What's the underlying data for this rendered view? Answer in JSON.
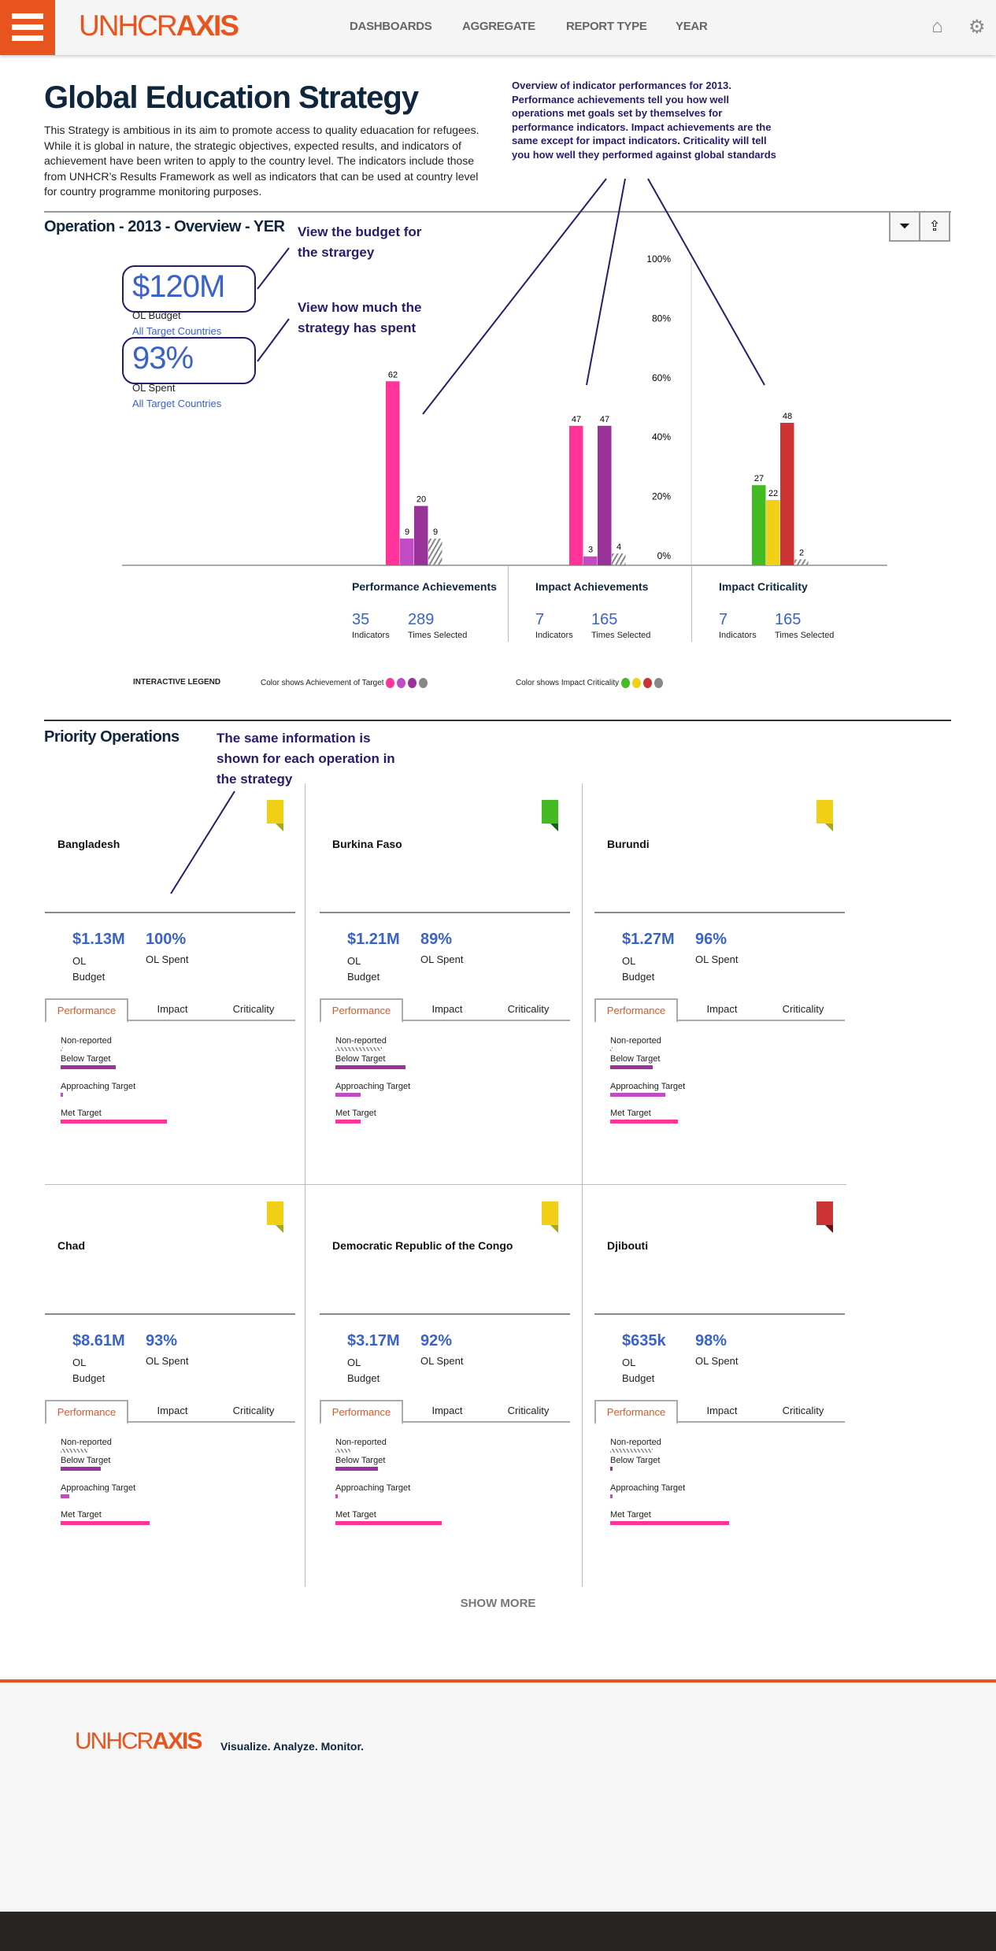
{
  "header": {
    "logo_light": "UNHCR",
    "logo_bold": "AXIS",
    "nav": [
      "DASHBOARDS",
      "AGGREGATE",
      "REPORT TYPE",
      "YEAR"
    ],
    "icons": [
      "menu-icon",
      "home-icon",
      "gear-icon"
    ]
  },
  "page": {
    "title": "Global Education Strategy",
    "intro": "This Strategy is ambitious in its aim to promote access to quality eduacation for refugees. While it is global in nature, the strategic objectives, expected results, and indicators of achievement have been writen to apply to the country level. The indicators include those from UNHCR’s Results Framework as well as indicators that can be used at country level for country programme monitoring purposes."
  },
  "annotations": {
    "overview": "Overview of indicator performances for 2013. Performance achievements tell you how well operations met goals set by themselves for performance indicators. Impact achievements are the same except for impact indicators. Criticality will tell you how well they performed against global standards",
    "budget": "View the budget for the strargey",
    "spent": "View how much the strategy has spent",
    "operations": "The same information is shown for each operation in the strategy"
  },
  "overview": {
    "title": "Operation - 2013 - Overview - YER",
    "budget_value": "$120M",
    "budget_label": "OL Budget",
    "spent_value": "93%",
    "spent_label": "OL Spent",
    "scope_link": "All Target Countries",
    "toolbar": [
      "filter-icon",
      "export-icon"
    ]
  },
  "chart_data": {
    "type": "bar",
    "ylim": [
      0,
      100
    ],
    "ytick_labels": [
      "0%",
      "20%",
      "40%",
      "60%",
      "80%",
      "100%"
    ],
    "grid": false,
    "groups": [
      {
        "name": "Performance Achievements",
        "values": [
          62,
          9,
          20,
          9
        ],
        "colors": [
          "#ff3399",
          "#c04bc4",
          "#993399",
          "hatched"
        ],
        "indicators": "35",
        "times_selected": "289"
      },
      {
        "name": "Impact Achievements",
        "values": [
          47,
          3,
          47,
          4
        ],
        "colors": [
          "#ff3399",
          "#c04bc4",
          "#993399",
          "hatched"
        ],
        "indicators": "7",
        "times_selected": "165"
      },
      {
        "name": "Impact Criticality",
        "values": [
          27,
          22,
          48,
          2
        ],
        "colors": [
          "#44bb22",
          "#f2d016",
          "#cc3333",
          "hatched"
        ],
        "indicators": "7",
        "times_selected": "165"
      }
    ],
    "stat_labels": {
      "indicators": "Indicators",
      "times_selected": "Times Selected"
    }
  },
  "legend": {
    "title": "INTERACTIVE LEGEND",
    "achievement": "Color shows Achievement of Target",
    "achievement_colors": [
      "#ff3399",
      "#c04bc4",
      "#993399",
      "#888888"
    ],
    "criticality_prefix": "Color shows ",
    "criticality_suffix": "Impact Criticality",
    "criticality_colors": [
      "#44bb22",
      "#f2d016",
      "#cc3333",
      "#888888"
    ]
  },
  "priority": {
    "title": "Priority Operations",
    "tabs": [
      "Performance",
      "Impact",
      "Criticality"
    ],
    "budget_label": "OL Budget",
    "spent_label": "OL Spent",
    "rows": [
      "Non-reported",
      "Below Target",
      "Approaching Target",
      "Met Target"
    ],
    "operations": [
      {
        "name": "Bangladesh",
        "budget": "$1.13M",
        "spent": "100%",
        "flag": "#f2d016",
        "fold": "#a8a820",
        "bars": [
          1,
          26,
          1,
          50
        ]
      },
      {
        "name": "Burkina Faso",
        "budget": "$1.21M",
        "spent": "89%",
        "flag": "#44bb22",
        "fold": "#116611",
        "bars": [
          22,
          33,
          12,
          12
        ]
      },
      {
        "name": "Burundi",
        "budget": "$1.27M",
        "spent": "96%",
        "flag": "#f2d016",
        "fold": "#a8a820",
        "bars": [
          1,
          20,
          26,
          32
        ]
      },
      {
        "name": "Chad",
        "budget": "$8.61M",
        "spent": "93%",
        "flag": "#f2d016",
        "fold": "#a8a820",
        "bars": [
          13,
          19,
          4,
          42
        ]
      },
      {
        "name": "Democratic Republic of the Congo",
        "budget": "$3.17M",
        "spent": "92%",
        "flag": "#f2d016",
        "fold": "#a8a820",
        "bars": [
          7,
          20,
          1,
          50
        ]
      },
      {
        "name": "Djibouti",
        "budget": "$635k",
        "spent": "98%",
        "flag": "#cc3333",
        "fold": "#6a1010",
        "bars": [
          20,
          1,
          1,
          56
        ]
      }
    ],
    "show_more": "SHOW MORE"
  },
  "footer": {
    "logo_light": "UNHCR",
    "logo_bold": "AXIS",
    "tagline": "Visualize. Analyze. Monitor."
  }
}
